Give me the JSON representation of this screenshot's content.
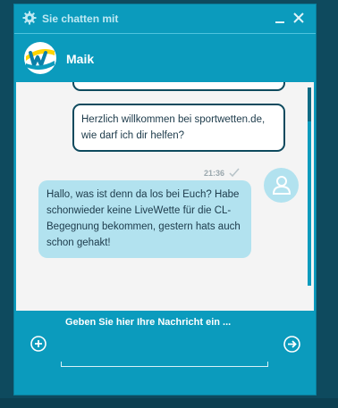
{
  "window": {
    "title": "Sie chatten mit"
  },
  "agent": {
    "name": "Maik"
  },
  "messages": [
    {
      "from": "agent",
      "text": ""
    },
    {
      "from": "agent",
      "text": "Herzlich willkommen bei sportwetten.de, wie darf ich dir helfen?"
    },
    {
      "from": "user",
      "time": "21:36",
      "text": "Hallo, was ist denn da los bei Euch? Habe schonwieder keine LiveWette für die CL-Begegnung bekommen, gestern hats auch schon gehakt!"
    }
  ],
  "compose": {
    "placeholder": "Geben Sie hier Ihre Nachricht ein ..."
  },
  "colors": {
    "header": "#0b9bbd",
    "border": "#0e4a5e",
    "user_bubble": "#b2e2ef",
    "chat_bg": "#f4f4f4"
  },
  "icons": [
    "gear-icon",
    "minimize-icon",
    "close-icon",
    "brand-logo",
    "check-icon",
    "user-avatar-icon",
    "add-icon",
    "send-icon"
  ]
}
